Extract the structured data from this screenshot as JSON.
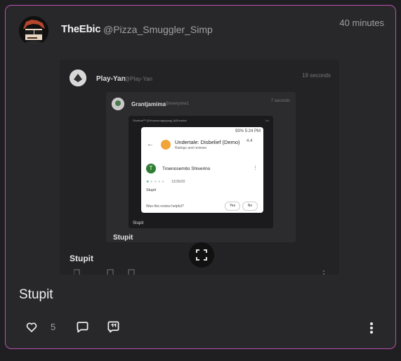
{
  "post": {
    "display_name": "TheEbic",
    "handle": "@Pizza_Smuggler_Simp",
    "time": "40 minutes",
    "text": "Stupit",
    "likes": "5"
  },
  "embed": {
    "display_name": "Play-Yan",
    "handle": "@Play-Yan",
    "time": "19 seconds",
    "text": "Stupit",
    "inner": {
      "display_name": "Grantjamima",
      "handle": "@everyone1",
      "time": "7 seconds",
      "text": "Stupit",
      "screenshot": {
        "header": "Shoebat™ (Enhamomagegang) @Shoebat",
        "time": "1m",
        "text": "Stupit",
        "dialog": {
          "status": "93% 5:24 PM",
          "title": "Undertale: Disbelief (Demo)",
          "rating": "4.4",
          "subtitle": "Ratings and reviews",
          "reviewer_initial": "T",
          "reviewer_name": "Troenosemito Shiverino",
          "date": "12/26/20",
          "review": "Stupit",
          "helpful_prompt": "Was this review helpful?",
          "yes_label": "Yes",
          "no_label": "No"
        }
      }
    }
  },
  "icons": {
    "like": "heart-icon",
    "reply": "reply-icon",
    "quote": "quote-icon",
    "more": "more-vertical-icon",
    "expand": "expand-icon"
  },
  "colors": {
    "accent_border": "#b94fb0",
    "background": "#28282a"
  }
}
